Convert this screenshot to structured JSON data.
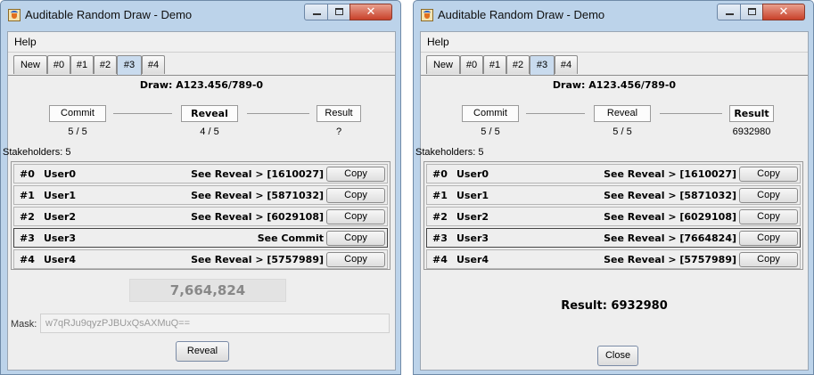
{
  "left": {
    "title": "Auditable Random Draw - Demo",
    "menu": {
      "help": "Help"
    },
    "tabs": [
      "New",
      "#0",
      "#1",
      "#2",
      "#3",
      "#4"
    ],
    "selected_tab": "#3",
    "draw": "Draw:  A123.456/789-0",
    "steps": {
      "commit": "Commit",
      "reveal": "Reveal",
      "result": "Result",
      "active": "reveal"
    },
    "counts": {
      "commit": "5 / 5",
      "reveal": "4 / 5",
      "result": "?"
    },
    "stakeholders_label": "Stakeholders: 5",
    "rows": [
      {
        "idx": "#0",
        "user": "User0",
        "status": "See Reveal > [1610027]",
        "copy": "Copy"
      },
      {
        "idx": "#1",
        "user": "User1",
        "status": "See Reveal > [5871032]",
        "copy": "Copy"
      },
      {
        "idx": "#2",
        "user": "User2",
        "status": "See Reveal > [6029108]",
        "copy": "Copy"
      },
      {
        "idx": "#3",
        "user": "User3",
        "status": "See Commit",
        "copy": "Copy"
      },
      {
        "idx": "#4",
        "user": "User4",
        "status": "See Reveal > [5757989]",
        "copy": "Copy"
      }
    ],
    "value": "7,664,824",
    "mask_label": "Mask:",
    "mask_value": "w7qRJu9qyzPJBUxQsAXMuQ==",
    "action": "Reveal"
  },
  "right": {
    "title": "Auditable Random Draw - Demo",
    "menu": {
      "help": "Help"
    },
    "tabs": [
      "New",
      "#0",
      "#1",
      "#2",
      "#3",
      "#4"
    ],
    "selected_tab": "#3",
    "draw": "Draw:  A123.456/789-0",
    "steps": {
      "commit": "Commit",
      "reveal": "Reveal",
      "result": "Result",
      "active": "result"
    },
    "counts": {
      "commit": "5 / 5",
      "reveal": "5 / 5",
      "result": "6932980"
    },
    "stakeholders_label": "Stakeholders: 5",
    "rows": [
      {
        "idx": "#0",
        "user": "User0",
        "status": "See Reveal > [1610027]",
        "copy": "Copy"
      },
      {
        "idx": "#1",
        "user": "User1",
        "status": "See Reveal > [5871032]",
        "copy": "Copy"
      },
      {
        "idx": "#2",
        "user": "User2",
        "status": "See Reveal > [6029108]",
        "copy": "Copy"
      },
      {
        "idx": "#3",
        "user": "User3",
        "status": "See Reveal > [7664824]",
        "copy": "Copy"
      },
      {
        "idx": "#4",
        "user": "User4",
        "status": "See Reveal > [5757989]",
        "copy": "Copy"
      }
    ],
    "result_text": "Result: 6932980",
    "action": "Close"
  },
  "colors": {
    "window_frame": "#bcd3ea",
    "panel": "#eeeeee",
    "selected_tab": "#c9dbee",
    "close_button": "#c8412a"
  },
  "icons": [
    "java-app-icon",
    "minimize-icon",
    "maximize-icon",
    "close-icon"
  ]
}
